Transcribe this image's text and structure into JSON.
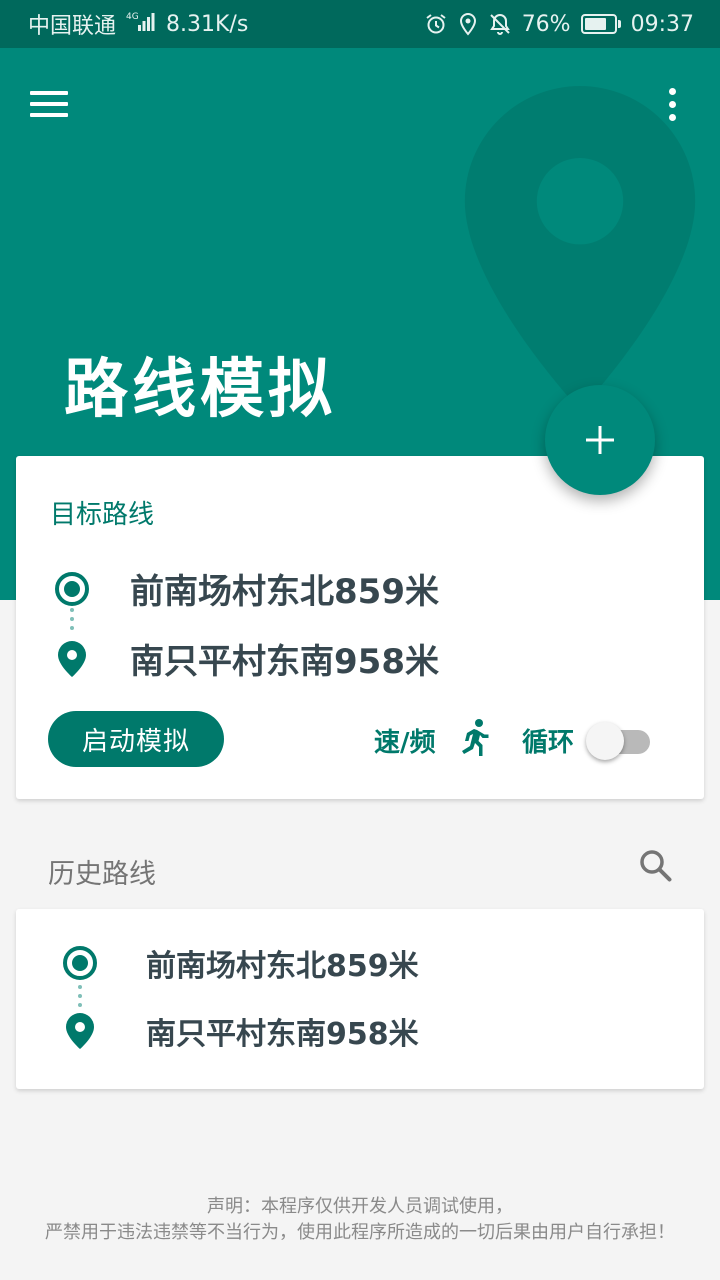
{
  "status_bar": {
    "carrier": "中国联通",
    "network": "4G",
    "speed": "8.31K/s",
    "battery": "76%",
    "battery_level": 0.76,
    "time": "09:37"
  },
  "header": {
    "title": "路线模拟",
    "menu_icon": "hamburger-menu-icon",
    "more_icon": "more-vert-icon",
    "fab_icon": "add-icon"
  },
  "target_card": {
    "label": "目标路线",
    "start": "前南场村东北859米",
    "end": "南只平村东南958米",
    "start_button": "启动模拟",
    "speed_label": "速/频",
    "speed_icon": "run-icon",
    "loop_label": "循环",
    "loop_enabled": false
  },
  "history": {
    "title": "历史路线",
    "search_icon": "search-icon",
    "items": [
      {
        "start": "前南场村东北859米",
        "end": "南只平村东南958米"
      }
    ]
  },
  "disclaimer": {
    "line1": "声明：本程序仅供开发人员调试使用，",
    "line2": "严禁用于违法违禁等不当行为，使用此程序所造成的一切后果由用户自行承担！"
  },
  "colors": {
    "primary": "#00897b",
    "primary_dark": "#00695c",
    "accent_text": "#00796b"
  }
}
